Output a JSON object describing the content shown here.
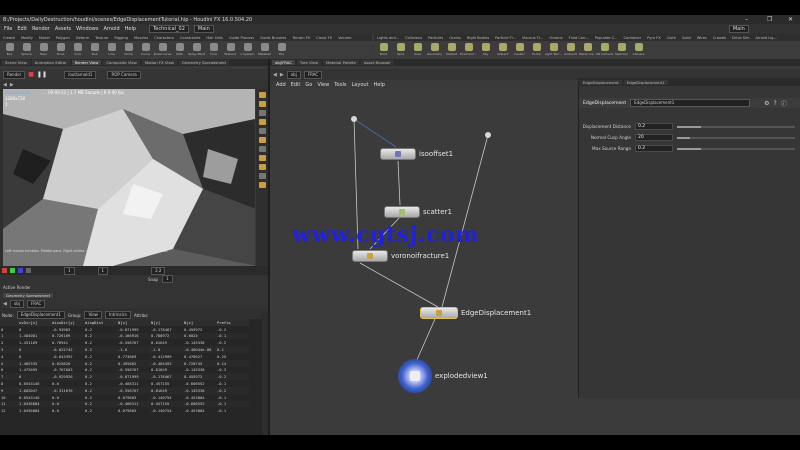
{
  "title": "B:/Projects/DailyDestruction/houdini/scenes/EdgeDisplacementTutorial.hip - Houdini FX 16.0.504.20",
  "window_controls": [
    "–",
    "❐",
    "✕"
  ],
  "menu": [
    "File",
    "Edit",
    "Render",
    "Assets",
    "Windows",
    "Arnold",
    "Help"
  ],
  "desktop": {
    "label": "Technical_02",
    "main": "Main",
    "main_right": "Main"
  },
  "shelf_left_tabs": [
    "Create",
    "Modify",
    "Model",
    "Polygon",
    "Deform",
    "Texture",
    "Rigging",
    "Muscles",
    "Characters",
    "Constraints",
    "Hair Utils",
    "Guide Process",
    "Guide Brushes",
    "Terrain FX",
    "Cloud FX",
    "Volume"
  ],
  "shelf_left_tools": [
    "Box",
    "Sphere",
    "Tube",
    "Torus",
    "Grid",
    "Null",
    "Line",
    "Circle",
    "Curve",
    "Draw Curve",
    "Path",
    "Spray Paint",
    "Font",
    "Platonic",
    "L-System",
    "Metaball",
    "File"
  ],
  "shelf_right_tabs": [
    "Lights and...",
    "Collisions",
    "Particles",
    "Grains",
    "Rigid Bodies",
    "Particle Fl...",
    "Viscous Fl...",
    "Oceans",
    "Fluid Con...",
    "Populate C...",
    "Container",
    "Pyro FX",
    "Cloth",
    "Solid",
    "Wires",
    "Crowds",
    "Drive Sim",
    "Arnold Lig..."
  ],
  "shelf_right_tools": [
    "Point",
    "Spot",
    "Area",
    "Geometry",
    "Distant",
    "Environm...",
    "Sky",
    "Indirect",
    "Caustic",
    "Portal",
    "Light Tem...",
    "Ambient",
    "Stereo Ca...",
    "VR Camera",
    "Switcher",
    "Camera"
  ],
  "left_panel_tabs": [
    "Scene View",
    "Animation Editor",
    "Render View",
    "Composite View",
    "Motion FX View",
    "Geometry Spreadsheet"
  ],
  "mid_panel_tabs": [
    "obj/FRAC",
    "Tree View",
    "Material Palette",
    "Asset Browser"
  ],
  "viewport": {
    "render_label": "Render",
    "obj_path": "/out/arnold1",
    "camera": "ROP Camera",
    "overlay_path": "/out/arnold1",
    "overlay_info": "... 00:00:23 | 1.7 MB Sample | 8 0.00 fps",
    "resolution": "1280x720",
    "frame": "1",
    "status": "Left mouse tumbles. Middle pans. Right dollies. Ctrl+Alt+Left box-zooms. Ctrl+Right zooms out.",
    "timeline_start": "1",
    "timeline_end": "1",
    "zoom": "2.2",
    "snap_label": "Snap",
    "snap_value": "1",
    "active_render": "Active Render"
  },
  "spreadsheet": {
    "tab": "Geometry Spreadsheet",
    "path_obj": "obj",
    "path_frac": "FRAC",
    "node_label": "Node:",
    "node": "EdgeDisplacement1",
    "group_label": "Group:",
    "view_label": "View",
    "intrinsics_label": "Intrinsics",
    "attribs_label": "Attribs:",
    "columns": [
      "",
      "uvDir[x]",
      "disxDir[y]",
      "dispDist",
      "N[x]",
      "N[y]",
      "N[z]",
      "Prefix"
    ],
    "rows": [
      [
        "0",
        "0",
        "-0.93983",
        "0.2",
        "-0.871999",
        "-0.178467",
        "0.455972",
        "-0.2"
      ],
      [
        "1",
        "1.484081",
        "0.726169",
        "0.2",
        "-0.166916",
        "0.788972",
        "0.6024",
        "-0.1"
      ],
      [
        "2",
        "1.451169",
        "0.76941",
        "0.2",
        "-0.558767",
        "0.81649",
        "-0.145338",
        "-0.2"
      ],
      [
        "3",
        "0",
        "-0.822742",
        "0.2",
        "-1.0",
        "-1.0",
        "-0.48044e-08",
        "0.1"
      ],
      [
        "4",
        "0",
        "-0.643392",
        "0.2",
        "0.774669",
        "-0.412909",
        "0.478627",
        "0.25"
      ],
      [
        "5",
        "1.465335",
        "0.625826",
        "0.2",
        "0.495662",
        "-0.464493",
        "0.728745",
        "0.14"
      ],
      [
        "6",
        "1.472695",
        "-0.767603",
        "0.2",
        "-0.558767",
        "0.81649",
        "-0.145338",
        "-0.3"
      ],
      [
        "7",
        "0",
        "-0.929926",
        "0.2",
        "-0.871999",
        "-0.178467",
        "0.455972",
        "-0.2"
      ],
      [
        "8",
        "0.6543146",
        "0.0",
        "0.2",
        "-0.466311",
        "0.457155",
        "-0.606552",
        "-0.1"
      ],
      [
        "9",
        "1.602047",
        "-0.311676",
        "0.2",
        "-0.558767",
        "0.81649",
        "-0.145338",
        "-0.2"
      ],
      [
        "10",
        "0.6543146",
        "0.0",
        "0.2",
        "0.079603",
        "-0.140754",
        "-0.453804",
        "-0.1"
      ],
      [
        "11",
        "1.0436084",
        "0.0",
        "0.2",
        "-0.466311",
        "0.457155",
        "-0.606552",
        "-0.1"
      ],
      [
        "12",
        "1.0436084",
        "0.0",
        "0.2",
        "0.079603",
        "-0.140754",
        "-0.453804",
        "-0.1"
      ]
    ]
  },
  "network": {
    "path_obj": "obj",
    "path_frac": "FRAC",
    "menu": [
      "Add",
      "Edit",
      "Go",
      "View",
      "Tools",
      "Layout",
      "Help"
    ],
    "watermark": "www.cgtsj.com",
    "nodes": [
      {
        "name": "isooffset1",
        "glyph_color": "#6c7ab8"
      },
      {
        "name": "scatter1",
        "glyph_color": "#9fbf6a"
      },
      {
        "name": "voronoifracture1",
        "glyph_color": "#c8a040"
      },
      {
        "name": "EdgeDisplacement1",
        "glyph_color": "#c8a040"
      },
      {
        "name": "explodedview1",
        "glyph_color": "#d0d0ff"
      }
    ]
  },
  "params": {
    "tabs": [
      "EdgeDisplacement",
      "EdgeDisplacement1"
    ],
    "node_type": "EdgeDisplacement",
    "node_name": "EdgeDisplacement1",
    "rows": [
      {
        "label": "Displacement Distance",
        "value": "0.2",
        "fraction": 0.2
      },
      {
        "label": "Normal Cusp Angle",
        "value": "20",
        "fraction": 0.11
      },
      {
        "label": "Max Source Range",
        "value": "0.2",
        "fraction": 0.2
      }
    ]
  }
}
